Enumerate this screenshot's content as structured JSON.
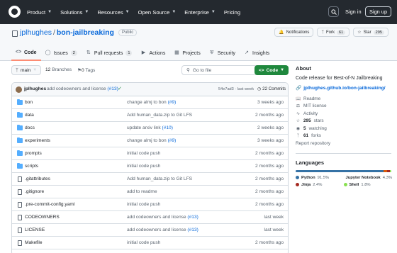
{
  "topnav": {
    "items": [
      {
        "label": "Product",
        "has_chevron": true
      },
      {
        "label": "Solutions",
        "has_chevron": true
      },
      {
        "label": "Resources",
        "has_chevron": true
      },
      {
        "label": "Open Source",
        "has_chevron": true
      },
      {
        "label": "Enterprise",
        "has_chevron": true
      },
      {
        "label": "Pricing",
        "has_chevron": false
      }
    ],
    "signin": "Sign in",
    "signup": "Sign up"
  },
  "repo": {
    "owner": "jplhughes",
    "separator": "/",
    "name": "bon-jailbreaking",
    "visibility": "Public",
    "notifications_label": "Notifications",
    "fork_label": "Fork",
    "fork_count": "61",
    "star_label": "Star",
    "star_count": "295"
  },
  "tabs": [
    {
      "label": "Code",
      "icon": "code-icon",
      "count": null
    },
    {
      "label": "Issues",
      "icon": "issue-icon",
      "count": "2"
    },
    {
      "label": "Pull requests",
      "icon": "pull-request-icon",
      "count": "1"
    },
    {
      "label": "Actions",
      "icon": "play-icon",
      "count": null
    },
    {
      "label": "Projects",
      "icon": "table-icon",
      "count": null
    },
    {
      "label": "Security",
      "icon": "shield-icon",
      "count": null
    },
    {
      "label": "Insights",
      "icon": "graph-icon",
      "count": null
    }
  ],
  "branch": {
    "name": "main",
    "branches_count": "12",
    "branches_label": "Branches",
    "tags_count": "0",
    "tags_label": "Tags",
    "goto_placeholder": "Go to file",
    "code_button": "Code"
  },
  "latest_commit": {
    "author": "jplhughes",
    "message": "add codeowners and license",
    "pr": "(#13)",
    "hash_time": "54e7ad3 · last week",
    "commits_count": "22 Commits"
  },
  "files": [
    {
      "type": "dir",
      "name": "bon",
      "msg": "change almj to bon",
      "pr": "(#9)",
      "time": "3 weeks ago"
    },
    {
      "type": "dir",
      "name": "data",
      "msg": "Add human_data.zip to Git LFS",
      "pr": "",
      "time": "2 months ago"
    },
    {
      "type": "dir",
      "name": "docs",
      "msg": "update arxiv link",
      "pr": "(#10)",
      "time": "2 weeks ago"
    },
    {
      "type": "dir",
      "name": "experiments",
      "msg": "change almj to bon",
      "pr": "(#9)",
      "time": "3 weeks ago"
    },
    {
      "type": "dir",
      "name": "prompts",
      "msg": "initial code push",
      "pr": "",
      "time": "2 months ago"
    },
    {
      "type": "dir",
      "name": "scripts",
      "msg": "initial code push",
      "pr": "",
      "time": "2 months ago"
    },
    {
      "type": "file",
      "name": ".gitattributes",
      "msg": "Add human_data.zip to Git LFS",
      "pr": "",
      "time": "2 months ago"
    },
    {
      "type": "file",
      "name": ".gitignore",
      "msg": "add to readme",
      "pr": "",
      "time": "2 months ago"
    },
    {
      "type": "file",
      "name": ".pre-commit-config.yaml",
      "msg": "initial code push",
      "pr": "",
      "time": "2 months ago"
    },
    {
      "type": "file",
      "name": "CODEOWNERS",
      "msg": "add codeowners and license",
      "pr": "(#13)",
      "time": "last week"
    },
    {
      "type": "file",
      "name": "LICENSE",
      "msg": "add codeowners and license",
      "pr": "(#13)",
      "time": "last week"
    },
    {
      "type": "file",
      "name": "Makefile",
      "msg": "initial code push",
      "pr": "",
      "time": "2 months ago"
    }
  ],
  "about": {
    "heading": "About",
    "description": "Code release for Best-of-N Jailbreaking",
    "link": "jplhughes.github.io/bon-jailbreaking/",
    "items": [
      {
        "icon": "book-icon",
        "strong": "",
        "text": "Readme"
      },
      {
        "icon": "law-icon",
        "strong": "",
        "text": "MIT license"
      },
      {
        "icon": "pulse-icon",
        "strong": "",
        "text": "Activity"
      },
      {
        "icon": "star-icon",
        "strong": "295",
        "text": "stars"
      },
      {
        "icon": "eye-icon",
        "strong": "5",
        "text": "watching"
      },
      {
        "icon": "fork-icon",
        "strong": "61",
        "text": "forks"
      }
    ],
    "report": "Report repository"
  },
  "languages": {
    "heading": "Languages",
    "list": [
      {
        "name": "Python",
        "pct": "91.5%",
        "value": 91.5,
        "color": "#3572A5"
      },
      {
        "name": "Jupyter Notebook",
        "pct": "4.3%",
        "value": 4.3,
        "color": "#DA5B0B"
      },
      {
        "name": "Jinja",
        "pct": "2.4%",
        "value": 2.4,
        "color": "#a52a22"
      },
      {
        "name": "Shell",
        "pct": "1.8%",
        "value": 1.8,
        "color": "#89e051"
      }
    ]
  }
}
